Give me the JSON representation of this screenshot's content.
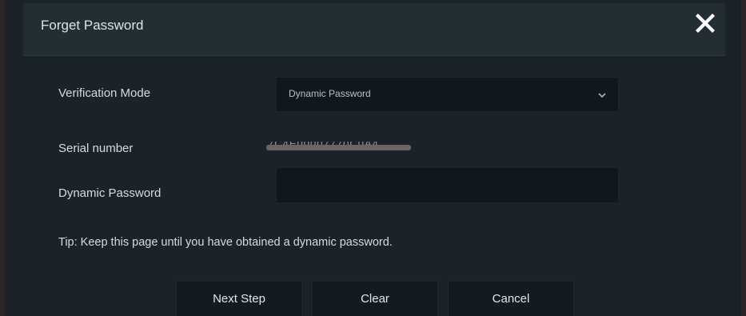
{
  "dialog": {
    "title": "Forget Password",
    "close_icon": "close-icon"
  },
  "form": {
    "verification_mode": {
      "label": "Verification Mode",
      "selected": "Dynamic Password",
      "icon": "chevron-down-icon"
    },
    "serial_number": {
      "label": "Serial number",
      "value": "7C4E00007770C0A4"
    },
    "dynamic_password": {
      "label": "Dynamic Password",
      "value": ""
    }
  },
  "tip": "Tip: Keep this page until you have obtained a dynamic password.",
  "buttons": {
    "next": "Next Step",
    "clear": "Clear",
    "cancel": "Cancel"
  },
  "colors": {
    "dialog_bg": "#1a2329",
    "header_bg": "#222d34",
    "field_bg": "#11181d",
    "text": "#d6dbde"
  }
}
